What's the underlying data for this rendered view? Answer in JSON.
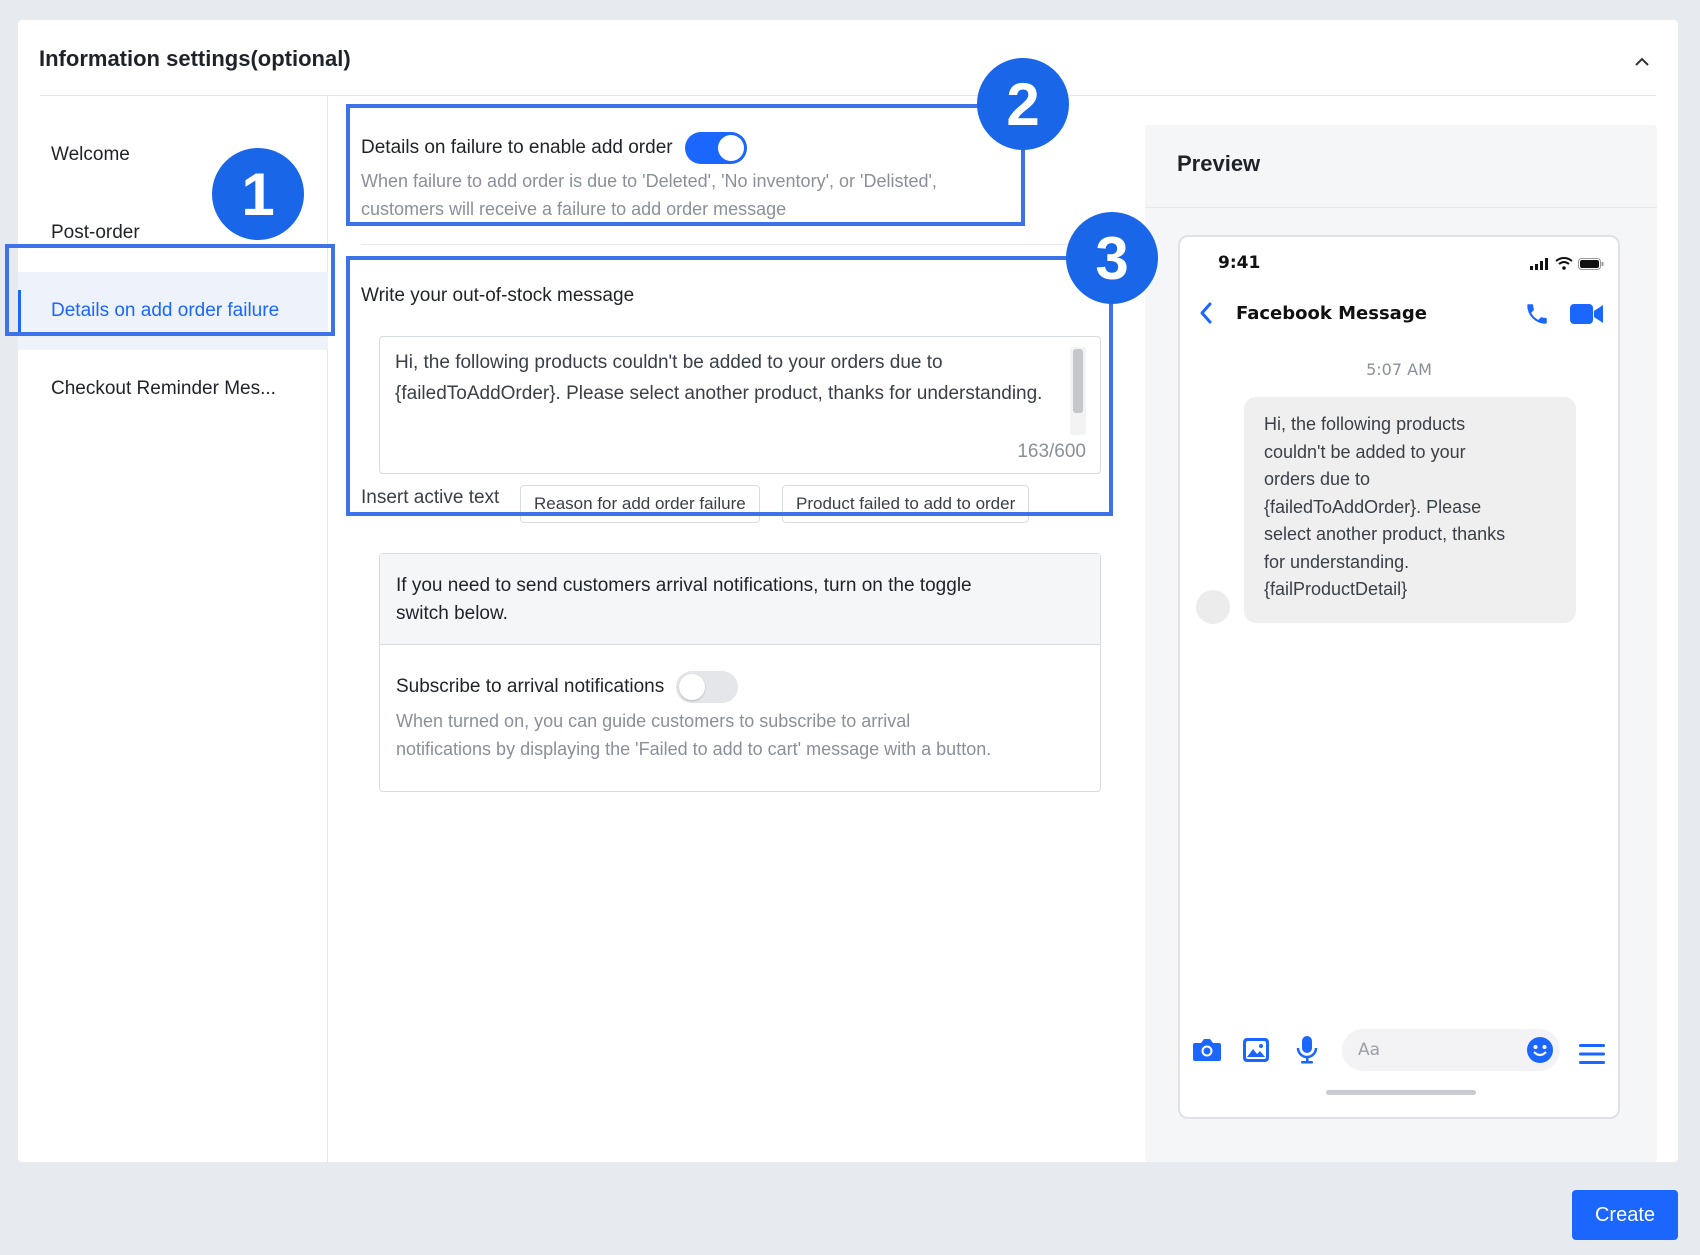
{
  "section": {
    "title": "Information settings(optional)",
    "collapse_icon": "chevron-up-icon"
  },
  "sidebar": {
    "items": [
      {
        "label": "Welcome",
        "active": false
      },
      {
        "label": "Post-order",
        "active": false
      },
      {
        "label": "Details on add order failure",
        "active": true
      },
      {
        "label": "Checkout Reminder Mes...",
        "active": false
      }
    ]
  },
  "annotations": {
    "badge_1": "1",
    "badge_2": "2",
    "badge_3": "3",
    "highlight_color": "#3e72e8",
    "badge_color": "#1a66e8"
  },
  "failure_details": {
    "title": "Details on failure to enable add order",
    "toggle_on": true,
    "hint_line1": "When failure to add order is due to 'Deleted', 'No inventory', or 'Delisted',",
    "hint_line2": "customers will receive a failure to add order message"
  },
  "message_editor": {
    "title": "Write your out-of-stock message",
    "value": "Hi, the following products couldn't be added to your orders due to {failedToAddOrder}. Please select another product, thanks for understanding.",
    "counter": "163/600",
    "insert_label": "Insert active text",
    "chips": [
      "Reason for add order failure",
      "Product failed to add to order"
    ]
  },
  "arrival_notify": {
    "header_line1": "If you need to send customers arrival notifications, turn on the toggle",
    "header_line2": "switch below.",
    "title": "Subscribe to arrival notifications",
    "toggle_on": false,
    "hint_line1": "When turned on, you can guide customers to subscribe to arrival",
    "hint_line2": "notifications by displaying the 'Failed to add to cart' message with a button."
  },
  "preview": {
    "title": "Preview",
    "phone": {
      "status_time": "9:41",
      "chat_title": "Facebook Message",
      "message_time": "5:07 AM",
      "bubble_lines": [
        "Hi, the following products",
        "couldn't be added to your",
        "orders due to",
        "{failedToAddOrder}. Please",
        "select another product, thanks",
        "for understanding.",
        "{failProductDetail}"
      ],
      "composer_placeholder": "Aa",
      "icons": [
        "back-chevron-icon",
        "phone-icon",
        "video-icon",
        "camera-icon",
        "image-icon",
        "mic-icon",
        "emoji-icon",
        "menu-icon"
      ]
    }
  },
  "actions": {
    "create_label": "Create",
    "accent_color": "#1a66ff"
  }
}
